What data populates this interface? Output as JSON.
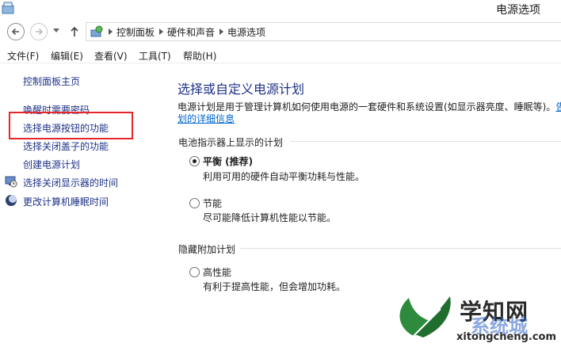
{
  "window": {
    "title": "电源选项"
  },
  "address": {
    "crumbs": [
      "控制面板",
      "硬件和声音",
      "电源选项"
    ]
  },
  "menu": [
    "文件(F)",
    "编辑(E)",
    "查看(V)",
    "工具(T)",
    "帮助(H)"
  ],
  "sidebar": {
    "home": "控制面板主页",
    "items": [
      {
        "label": "唤醒时需要密码",
        "icon": ""
      },
      {
        "label": "选择电源按钮的功能",
        "icon": ""
      },
      {
        "label": "选择关闭盖子的功能",
        "icon": ""
      },
      {
        "label": "创建电源计划",
        "icon": ""
      },
      {
        "label": "选择关闭显示器的时间",
        "icon": "monitor-clock-icon"
      },
      {
        "label": "更改计算机睡眠时间",
        "icon": "moon-sleep-icon"
      }
    ]
  },
  "main": {
    "title": "选择或自定义电源计划",
    "description_line1": "电源计划是用于管理计算机如何使用电源的一套硬件和系统设置(如显示器亮度、睡眠等)。",
    "description_link_start": "告",
    "description_link_end": "划的详细信息",
    "group_battery": "电池指示器上显示的计划",
    "plans": [
      {
        "name": "平衡 (推荐)",
        "desc": "利用可用的硬件自动平衡功耗与性能。",
        "checked": true
      },
      {
        "name": "节能",
        "desc": "尽可能降低计算机性能以节能。",
        "checked": false
      }
    ],
    "group_hidden": "隐藏附加计划",
    "hidden_plans": [
      {
        "name": "高性能",
        "desc": "有利于提高性能，但会增加功耗。",
        "checked": false
      }
    ]
  },
  "watermark": {
    "brand": "学知网",
    "brand2": "系统城",
    "url": "xitongcheng.com"
  },
  "colors": {
    "link": "#1e3287",
    "highlight": "#e8252b"
  }
}
